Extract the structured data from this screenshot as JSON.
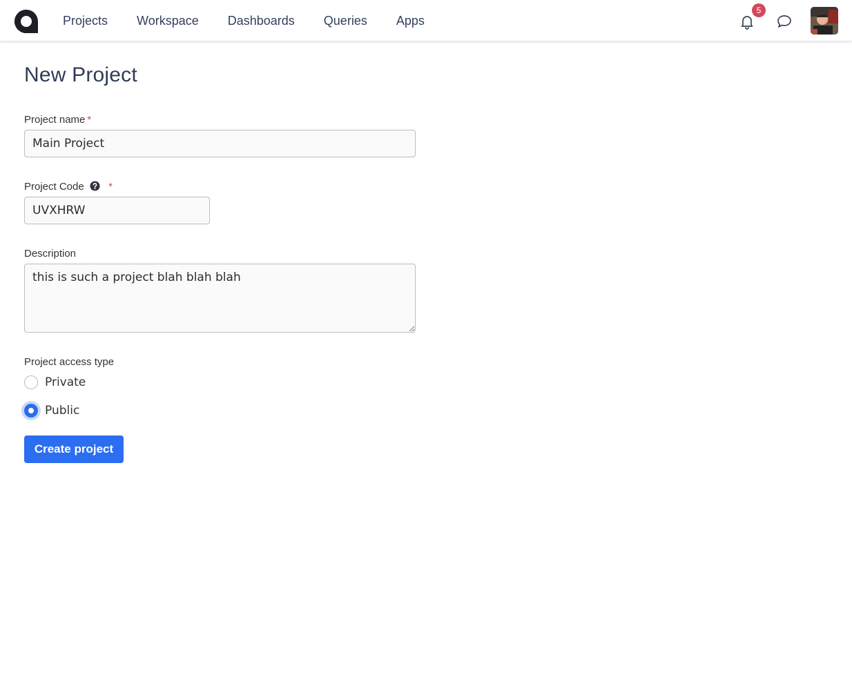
{
  "nav": {
    "items": [
      {
        "label": "Projects"
      },
      {
        "label": "Workspace"
      },
      {
        "label": "Dashboards"
      },
      {
        "label": "Queries"
      },
      {
        "label": "Apps"
      }
    ],
    "notifications_count": "5",
    "icons": {
      "logo": "app-logo",
      "bell": "bell-icon",
      "chat": "chat-bubble-icon",
      "avatar": "user-avatar"
    }
  },
  "page": {
    "title": "New Project"
  },
  "form": {
    "project_name": {
      "label": "Project name",
      "required": "*",
      "value": "Main Project"
    },
    "project_code": {
      "label": "Project Code",
      "required": "*",
      "value": "UVXHRW",
      "help_icon": "question-circle-icon"
    },
    "description": {
      "label": "Description",
      "value": "this is such a project blah blah blah"
    },
    "access_type": {
      "label": "Project access type",
      "options": [
        {
          "label": "Private",
          "checked": false
        },
        {
          "label": "Public",
          "checked": true
        }
      ]
    },
    "submit_label": "Create project"
  },
  "colors": {
    "primary": "#2c6ef2",
    "badge": "#d1495b",
    "required": "#d1495b",
    "nav_text": "#333f5c"
  }
}
